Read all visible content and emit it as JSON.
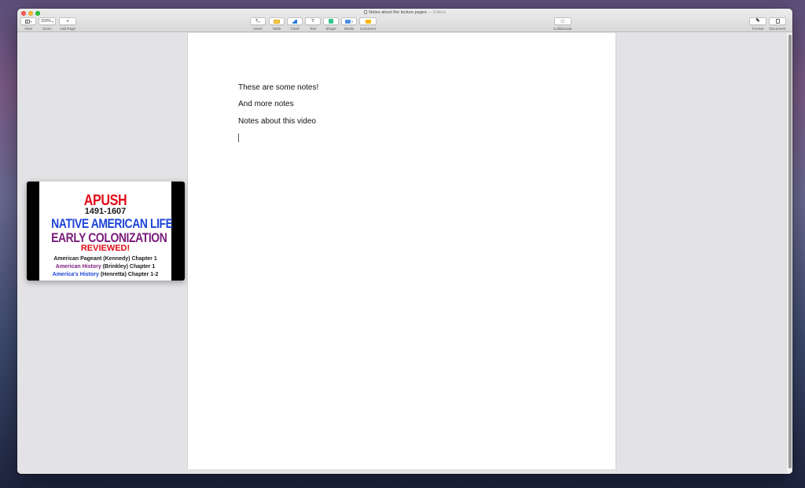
{
  "window": {
    "title": "Notes about the lecture.pages",
    "title_suffix": "— Edited"
  },
  "toolbar": {
    "view_label": "View",
    "zoom_value": "200%",
    "zoom_label": "Zoom",
    "add_page_label": "Add Page",
    "insert_label": "Insert",
    "insert_glyph": "¶",
    "table_label": "Table",
    "chart_label": "Chart",
    "text_label": "Text",
    "text_glyph": "T",
    "shape_label": "Shape",
    "media_label": "Media",
    "comment_label": "Comment",
    "collaborate_label": "Collaborate",
    "format_label": "Format",
    "document_label": "Document"
  },
  "document": {
    "lines": [
      "These are some notes!",
      "And more notes",
      "Notes about this video"
    ]
  },
  "video": {
    "title": "APUSH",
    "years": "1491-1607",
    "topic1": "NATIVE AMERICAN LIFE",
    "topic2": "EARLY COLONIZATION",
    "reviewed": "REVIEWED!",
    "ref1_book": "American Pageant",
    "ref1_rest": " (Kennedy) Chapter 1",
    "ref2_book": "American History",
    "ref2_rest": " (Brinkley) Chapter 1",
    "ref3_book": "America's History",
    "ref3_rest": " (Henretta) Chapter 1-2"
  },
  "colors": {
    "red": "#e30a17",
    "blue": "#1d44d8",
    "purple": "#7a1c7c"
  }
}
